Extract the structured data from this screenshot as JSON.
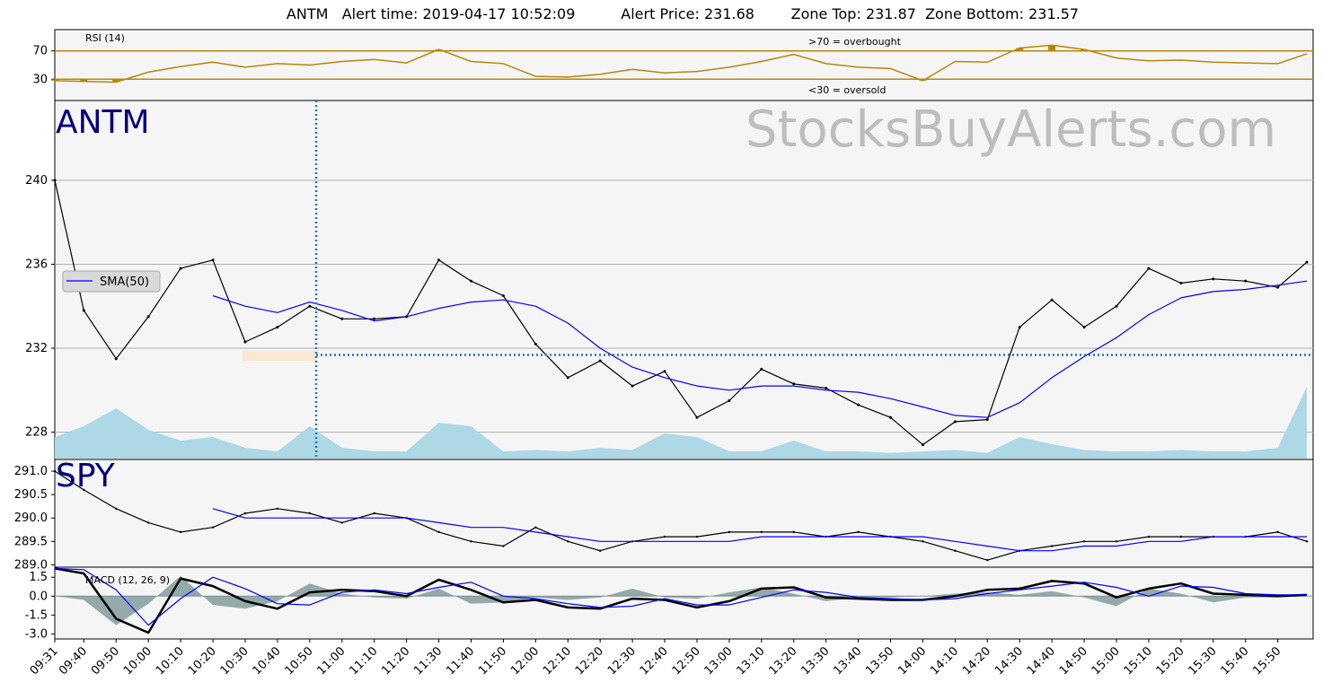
{
  "title": {
    "symbol": "ANTM",
    "alert_time_label": "Alert time: 2019-04-17 10:52:09",
    "alert_price_label": "Alert Price: 231.68",
    "zone_top_label": "Zone Top: 231.87",
    "zone_bottom_label": "Zone Bottom: 231.57"
  },
  "watermark": "StocksBuyAlerts.com",
  "colors": {
    "panel_bg": "#f5f5f5",
    "rsi_line": "#b8860b",
    "volume": "#add8e6",
    "sma": "#0000ff",
    "macd_line": "#000000",
    "signal_line": "#0000ff",
    "hist": "#5f7f7f",
    "alert_marker": "#1f77b4",
    "panel_label": "#000080",
    "zone": "#fbe8d2"
  },
  "chart_data": [
    {
      "name": "rsi",
      "type": "line",
      "label": "RSI (14)",
      "yticks": [
        30,
        70
      ],
      "ylim": [
        0,
        100
      ],
      "levels": [
        70,
        30
      ],
      "level_labels": [
        ">70 = overbought",
        "<30 = oversold"
      ],
      "x": [
        "09:31",
        "09:40",
        "09:50",
        "10:00",
        "10:10",
        "10:20",
        "10:30",
        "10:40",
        "10:50",
        "11:00",
        "11:10",
        "11:20",
        "11:30",
        "11:40",
        "11:50",
        "12:00",
        "12:10",
        "12:20",
        "12:30",
        "12:40",
        "12:50",
        "13:00",
        "13:10",
        "13:20",
        "13:30",
        "13:40",
        "13:50",
        "14:00",
        "14:10",
        "14:20",
        "14:30",
        "14:40",
        "14:50",
        "15:00",
        "15:10",
        "15:20",
        "15:30",
        "15:40",
        "15:50",
        "15:59"
      ],
      "values": [
        28,
        27,
        26,
        40,
        48,
        54,
        47,
        52,
        50,
        55,
        58,
        53,
        72,
        55,
        52,
        34,
        33,
        37,
        44,
        39,
        41,
        47,
        55,
        65,
        52,
        47,
        45,
        28,
        55,
        54,
        74,
        78,
        72,
        60,
        56,
        57,
        54,
        53,
        52,
        66
      ]
    },
    {
      "name": "antm_price",
      "type": "line",
      "label": "ANTM",
      "yticks": [
        228,
        232,
        236,
        240
      ],
      "ylim": [
        226.7,
        243.8
      ],
      "legend": "SMA(50)",
      "legend_position": "middle-left",
      "alert_time": "10:52",
      "alert_price": 231.68,
      "zone_top": 231.87,
      "zone_bottom": 231.57,
      "x": [
        "09:31",
        "09:40",
        "09:50",
        "10:00",
        "10:10",
        "10:20",
        "10:30",
        "10:40",
        "10:50",
        "11:00",
        "11:10",
        "11:20",
        "11:30",
        "11:40",
        "11:50",
        "12:00",
        "12:10",
        "12:20",
        "12:30",
        "12:40",
        "12:50",
        "13:00",
        "13:10",
        "13:20",
        "13:30",
        "13:40",
        "13:50",
        "14:00",
        "14:10",
        "14:20",
        "14:30",
        "14:40",
        "14:50",
        "15:00",
        "15:10",
        "15:20",
        "15:30",
        "15:40",
        "15:50",
        "15:59"
      ],
      "values": [
        240.0,
        233.8,
        231.5,
        233.5,
        235.8,
        236.2,
        232.3,
        233.0,
        234.0,
        233.4,
        233.4,
        233.5,
        236.2,
        235.2,
        234.5,
        232.2,
        230.6,
        231.4,
        230.2,
        230.9,
        228.7,
        229.5,
        231.0,
        230.3,
        230.1,
        229.3,
        228.7,
        227.4,
        228.5,
        228.6,
        233.0,
        234.3,
        233.0,
        234.0,
        235.8,
        235.1,
        235.3,
        235.2,
        234.9,
        236.1
      ],
      "sma_x": [
        "10:20",
        "10:30",
        "10:40",
        "10:50",
        "11:00",
        "11:10",
        "11:20",
        "11:30",
        "11:40",
        "11:50",
        "12:00",
        "12:10",
        "12:20",
        "12:30",
        "12:40",
        "12:50",
        "13:00",
        "13:10",
        "13:20",
        "13:30",
        "13:40",
        "13:50",
        "14:00",
        "14:10",
        "14:20",
        "14:30",
        "14:40",
        "14:50",
        "15:00",
        "15:10",
        "15:20",
        "15:30",
        "15:40",
        "15:50",
        "15:59"
      ],
      "sma": [
        234.5,
        234.0,
        233.7,
        234.2,
        233.8,
        233.3,
        233.5,
        233.9,
        234.2,
        234.3,
        234.0,
        233.2,
        232.0,
        231.1,
        230.6,
        230.2,
        230.0,
        230.2,
        230.2,
        230.0,
        229.9,
        229.6,
        229.2,
        228.8,
        228.7,
        229.4,
        230.6,
        231.6,
        232.5,
        233.6,
        234.4,
        234.7,
        234.8,
        235.0,
        235.2
      ],
      "volume": [
        0.3,
        0.45,
        0.7,
        0.4,
        0.25,
        0.3,
        0.15,
        0.1,
        0.45,
        0.15,
        0.1,
        0.1,
        0.5,
        0.45,
        0.1,
        0.12,
        0.1,
        0.15,
        0.12,
        0.35,
        0.3,
        0.1,
        0.1,
        0.25,
        0.1,
        0.1,
        0.08,
        0.1,
        0.12,
        0.08,
        0.3,
        0.2,
        0.12,
        0.1,
        0.1,
        0.12,
        0.1,
        0.1,
        0.15,
        1.0
      ]
    },
    {
      "name": "spy_price",
      "type": "line",
      "label": "SPY",
      "yticks": [
        289.0,
        289.5,
        290.0,
        290.5,
        291.0
      ],
      "ylim": [
        288.95,
        291.25
      ],
      "x": [
        "09:31",
        "09:40",
        "09:50",
        "10:00",
        "10:10",
        "10:20",
        "10:30",
        "10:40",
        "10:50",
        "11:00",
        "11:10",
        "11:20",
        "11:30",
        "11:40",
        "11:50",
        "12:00",
        "12:10",
        "12:20",
        "12:30",
        "12:40",
        "12:50",
        "13:00",
        "13:10",
        "13:20",
        "13:30",
        "13:40",
        "13:50",
        "14:00",
        "14:10",
        "14:20",
        "14:30",
        "14:40",
        "14:50",
        "15:00",
        "15:10",
        "15:20",
        "15:30",
        "15:40",
        "15:50",
        "15:59"
      ],
      "values": [
        291.0,
        290.6,
        290.2,
        289.9,
        289.7,
        289.8,
        290.1,
        290.2,
        290.1,
        289.9,
        290.1,
        290.0,
        289.7,
        289.5,
        289.4,
        289.8,
        289.5,
        289.3,
        289.5,
        289.6,
        289.6,
        289.7,
        289.7,
        289.7,
        289.6,
        289.7,
        289.6,
        289.5,
        289.3,
        289.1,
        289.3,
        289.4,
        289.5,
        289.5,
        289.6,
        289.6,
        289.6,
        289.6,
        289.7,
        289.5
      ],
      "sma_x": [
        "10:20",
        "10:30",
        "10:40",
        "10:50",
        "11:00",
        "11:10",
        "11:20",
        "11:30",
        "11:40",
        "11:50",
        "12:00",
        "12:10",
        "12:20",
        "12:30",
        "12:40",
        "12:50",
        "13:00",
        "13:10",
        "13:20",
        "13:30",
        "13:40",
        "13:50",
        "14:00",
        "14:10",
        "14:20",
        "14:30",
        "14:40",
        "14:50",
        "15:00",
        "15:10",
        "15:20",
        "15:30",
        "15:40",
        "15:50",
        "15:59"
      ],
      "sma": [
        290.2,
        290.0,
        290.0,
        290.0,
        290.0,
        290.0,
        290.0,
        289.9,
        289.8,
        289.8,
        289.7,
        289.6,
        289.5,
        289.5,
        289.5,
        289.5,
        289.5,
        289.6,
        289.6,
        289.6,
        289.6,
        289.6,
        289.6,
        289.5,
        289.4,
        289.3,
        289.3,
        289.4,
        289.4,
        289.5,
        289.5,
        289.6,
        289.6,
        289.6,
        289.6
      ]
    },
    {
      "name": "macd",
      "type": "line",
      "label": "MACD (12, 26, 9)",
      "yticks": [
        -3.0,
        -1.5,
        0.0,
        1.5
      ],
      "ylim": [
        -3.4,
        2.3
      ],
      "x": [
        "09:31",
        "09:40",
        "09:50",
        "10:00",
        "10:10",
        "10:20",
        "10:30",
        "10:40",
        "10:50",
        "11:00",
        "11:10",
        "11:20",
        "11:30",
        "11:40",
        "11:50",
        "12:00",
        "12:10",
        "12:20",
        "12:30",
        "12:40",
        "12:50",
        "13:00",
        "13:10",
        "13:20",
        "13:30",
        "13:40",
        "13:50",
        "14:00",
        "14:10",
        "14:20",
        "14:30",
        "14:40",
        "14:50",
        "15:00",
        "15:10",
        "15:20",
        "15:30",
        "15:40",
        "15:50",
        "15:59"
      ],
      "macd": [
        2.2,
        1.8,
        -1.8,
        -2.9,
        1.4,
        0.8,
        -0.4,
        -1.0,
        0.3,
        0.5,
        0.4,
        0.0,
        1.3,
        0.5,
        -0.5,
        -0.3,
        -0.9,
        -1.0,
        -0.2,
        -0.3,
        -0.9,
        -0.4,
        0.6,
        0.7,
        -0.1,
        -0.2,
        -0.3,
        -0.3,
        0.0,
        0.5,
        0.6,
        1.2,
        1.0,
        -0.1,
        0.6,
        1.0,
        0.2,
        0.1,
        0.0,
        0.1
      ],
      "signal": [
        2.2,
        2.1,
        0.5,
        -2.3,
        -0.2,
        1.5,
        0.6,
        -0.6,
        -0.7,
        0.3,
        0.5,
        0.2,
        0.7,
        1.1,
        0.0,
        -0.2,
        -0.6,
        -0.9,
        -0.8,
        -0.2,
        -0.7,
        -0.7,
        -0.1,
        0.5,
        0.3,
        -0.1,
        -0.2,
        -0.3,
        -0.2,
        0.2,
        0.5,
        0.8,
        1.1,
        0.7,
        0.0,
        0.8,
        0.7,
        0.2,
        0.1,
        0.1
      ],
      "x_tick_labels": [
        "09:31",
        "09:40",
        "09:50",
        "10:00",
        "10:10",
        "10:20",
        "10:30",
        "10:40",
        "10:50",
        "11:00",
        "11:10",
        "11:20",
        "11:30",
        "11:40",
        "11:50",
        "12:00",
        "12:10",
        "12:20",
        "12:30",
        "12:40",
        "12:50",
        "13:00",
        "13:10",
        "13:20",
        "13:30",
        "13:40",
        "13:50",
        "14:00",
        "14:10",
        "14:20",
        "14:30",
        "14:40",
        "14:50",
        "15:00",
        "15:10",
        "15:20",
        "15:30",
        "15:40",
        "15:50"
      ]
    }
  ]
}
